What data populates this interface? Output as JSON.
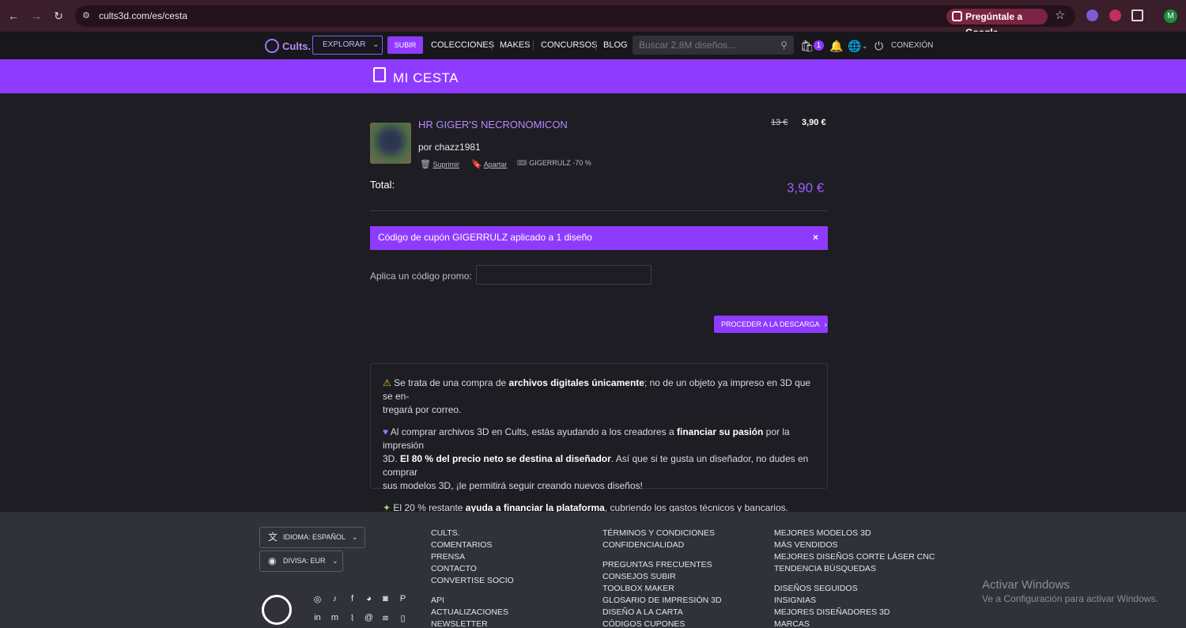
{
  "browser": {
    "url": "cults3d.com/es/cesta",
    "ask_google_label": "Pregúntale a Google",
    "profile_initial": "M"
  },
  "header": {
    "logo_text": "Cults.",
    "explorar_label": "EXPLORAR",
    "subir_label": "SUBIR",
    "nav": [
      "COLECCIONES",
      "MAKES",
      "CONCURSOS",
      "BLOG"
    ],
    "search_placeholder": "Buscar 2,8M diseños...",
    "cart_count": "1",
    "conexion_label": "CONEXIÓN"
  },
  "page": {
    "title": "MI CESTA"
  },
  "cart": {
    "item": {
      "title": "HR GIGER'S NECRONOMICON",
      "old_price": "13 €",
      "price": "3,90 €",
      "author": "por chazz1981",
      "delete_label": "Suprimir",
      "save_label": "Apartar",
      "coupon_tag": "GIGERRULZ -70 %"
    },
    "total_label": "Total:",
    "total_value": "3,90 €",
    "coupon_message": "Código de cupón GIGERRULZ aplicado a 1 diseño",
    "coupon_close": "×",
    "promo_label": "Aplica un código promo:",
    "proceed_label": "PROCEDER A LA DESCARGA"
  },
  "info": {
    "p1_a": "Se trata de una compra de ",
    "p1_b": "archivos digitales únicamente",
    "p1_c": "; no de un objeto ya impreso en 3D que se en-",
    "p1_d": "tregará por correo.",
    "p2_a": "Al comprar archivos 3D en Cults, estás ayudando a los creadores a ",
    "p2_b": "financiar su pasión",
    "p2_c": " por la impresión",
    "p2_d": "3D. ",
    "p2_e": "El 80 % del precio neto se destina al diseñador",
    "p2_f": ". Así que si te gusta un diseñador, no dudes en comprar",
    "p2_g": "sus modelos 3D, ¡le permitirá seguir creando nuevos diseños!",
    "p3_a": "El 20 % restante ",
    "p3_b": "ayuda a financiar la plataforma",
    "p3_c": ", cubriendo los gastos técnicos y bancarios."
  },
  "footer": {
    "language_label": "IDIOMA: ESPAÑOL",
    "currency_label": "DIVISA: EUR",
    "col1": [
      "CULTS.",
      "COMENTARIOS",
      "PRENSA",
      "CONTACTO",
      "CONVERTISE SOCIO"
    ],
    "col1b": [
      "API",
      "ACTUALIZACIONES",
      "NEWSLETTER"
    ],
    "col2": [
      "TÉRMINOS Y CONDICIONES",
      "CONFIDENCIALIDAD"
    ],
    "col2b": [
      "PREGUNTAS FRECUENTES",
      "CONSEJOS SUBIR",
      "TOOLBOX MAKER",
      "GLOSARIO DE IMPRESIÓN 3D",
      "DISEÑO A LA CARTA",
      "CÓDIGOS CUPONES"
    ],
    "col3": [
      "MEJORES MODELOS 3D",
      "MÁS VENDIDOS",
      "MEJORES DISEÑOS CORTE LÁSER CNC",
      "TENDENCIA BÚSQUEDAS"
    ],
    "col3b": [
      "DISEÑOS SEGUIDOS",
      "INSIGNIAS",
      "MEJORES DISEÑADORES 3D",
      "MARCAS"
    ]
  },
  "windows": {
    "line1": "Activar Windows",
    "line2": "Ve a Configuración para activar Windows."
  },
  "colors": {
    "accent": "#8f3bff",
    "background": "#1d1d23",
    "footer": "#31313a"
  }
}
